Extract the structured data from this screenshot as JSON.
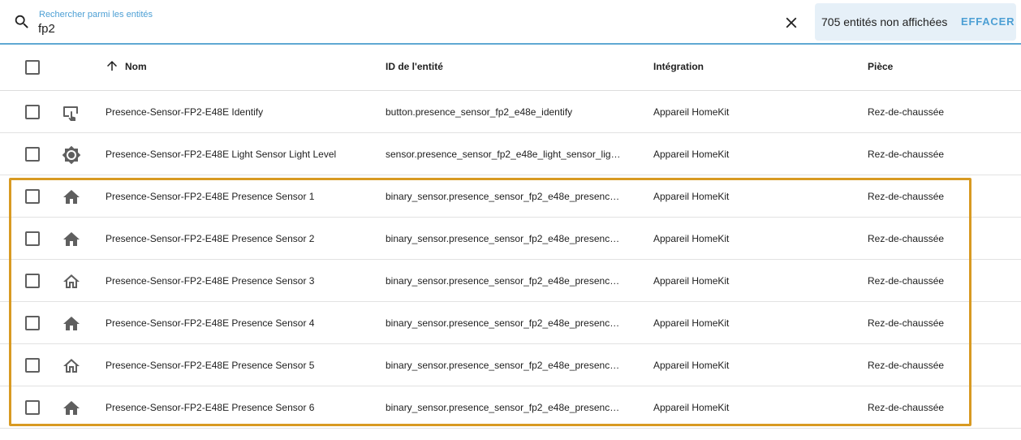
{
  "search": {
    "label": "Rechercher parmi les entités",
    "value": "fp2"
  },
  "filter": {
    "hidden_text": "705 entités non affichées",
    "clear_label": "EFFACER"
  },
  "table": {
    "columns": {
      "name": "Nom",
      "entity_id": "ID de l'entité",
      "integration": "Intégration",
      "room": "Pièce"
    },
    "rows": [
      {
        "icon": "gesture-tap-button-icon",
        "name": "Presence-Sensor-FP2-E48E Identify",
        "entity_id": "button.presence_sensor_fp2_e48e_identify",
        "integration": "Appareil HomeKit",
        "room": "Rez-de-chaussée"
      },
      {
        "icon": "brightness-icon",
        "name": "Presence-Sensor-FP2-E48E Light Sensor Light Level",
        "entity_id": "sensor.presence_sensor_fp2_e48e_light_sensor_lig…",
        "integration": "Appareil HomeKit",
        "room": "Rez-de-chaussée"
      },
      {
        "icon": "home-filled-icon",
        "name": "Presence-Sensor-FP2-E48E Presence Sensor 1",
        "entity_id": "binary_sensor.presence_sensor_fp2_e48e_presenc…",
        "integration": "Appareil HomeKit",
        "room": "Rez-de-chaussée"
      },
      {
        "icon": "home-filled-icon",
        "name": "Presence-Sensor-FP2-E48E Presence Sensor 2",
        "entity_id": "binary_sensor.presence_sensor_fp2_e48e_presenc…",
        "integration": "Appareil HomeKit",
        "room": "Rez-de-chaussée"
      },
      {
        "icon": "home-outline-icon",
        "name": "Presence-Sensor-FP2-E48E Presence Sensor 3",
        "entity_id": "binary_sensor.presence_sensor_fp2_e48e_presenc…",
        "integration": "Appareil HomeKit",
        "room": "Rez-de-chaussée"
      },
      {
        "icon": "home-filled-icon",
        "name": "Presence-Sensor-FP2-E48E Presence Sensor 4",
        "entity_id": "binary_sensor.presence_sensor_fp2_e48e_presenc…",
        "integration": "Appareil HomeKit",
        "room": "Rez-de-chaussée"
      },
      {
        "icon": "home-outline-icon",
        "name": "Presence-Sensor-FP2-E48E Presence Sensor 5",
        "entity_id": "binary_sensor.presence_sensor_fp2_e48e_presenc…",
        "integration": "Appareil HomeKit",
        "room": "Rez-de-chaussée"
      },
      {
        "icon": "home-filled-icon",
        "name": "Presence-Sensor-FP2-E48E Presence Sensor 6",
        "entity_id": "binary_sensor.presence_sensor_fp2_e48e_presenc…",
        "integration": "Appareil HomeKit",
        "room": "Rez-de-chaussée"
      }
    ]
  },
  "colors": {
    "accent": "#4c9fd4",
    "highlight": "#d89a22",
    "icon": "#5f5f5f"
  }
}
